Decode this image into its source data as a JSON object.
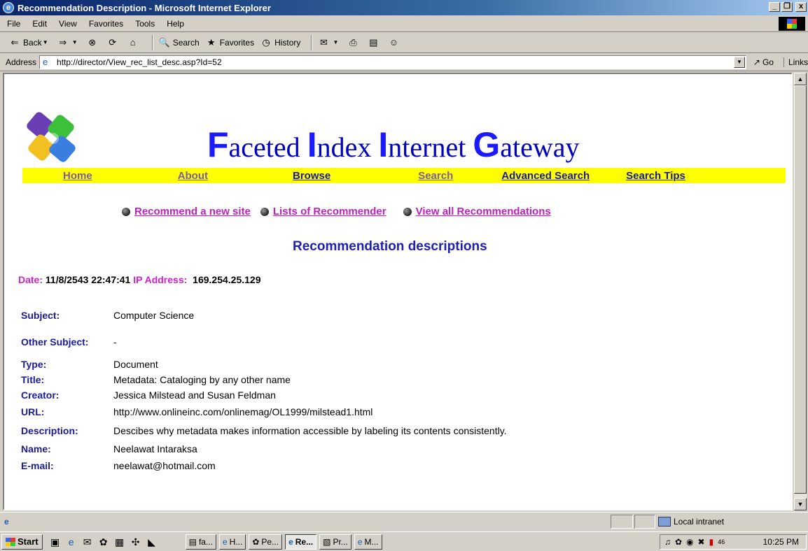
{
  "window": {
    "title": "Recommendation Description - Microsoft Internet Explorer",
    "buttons": [
      "_",
      "❐",
      "x"
    ]
  },
  "menu": [
    "File",
    "Edit",
    "View",
    "Favorites",
    "Tools",
    "Help"
  ],
  "toolbar": {
    "back": "Back",
    "search": "Search",
    "favorites": "Favorites",
    "history": "History"
  },
  "address": {
    "label": "Address",
    "url": "http://director/View_rec_list_desc.asp?Id=52",
    "go": "Go",
    "links": "Links"
  },
  "site": {
    "title_parts": [
      {
        "cap": "F",
        "rest": "aceted "
      },
      {
        "cap": "I",
        "rest": "ndex "
      },
      {
        "cap": "I",
        "rest": "nternet "
      },
      {
        "cap": "G",
        "rest": "ateway"
      }
    ],
    "nav": [
      "Home",
      "About",
      "Browse",
      "Search",
      "Advanced Search",
      "Search Tips"
    ],
    "recommend_links": [
      "Recommend a new site",
      "Lists of Recommender",
      "View all Recommendations"
    ],
    "heading": "Recommendation descriptions",
    "meta": {
      "date_label": "Date:",
      "date_value": "11/8/2543 22:47:41",
      "ip_label": "IP Address:",
      "ip_value": "169.254.25.129"
    },
    "fields": [
      {
        "label": "Subject:",
        "value": "Computer Science"
      },
      {
        "label": "Other Subject:",
        "value": "-"
      },
      {
        "label": "Type:",
        "value": "Document"
      },
      {
        "label": "Title:",
        "value": "Metadata: Cataloging by any other name"
      },
      {
        "label": "Creator:",
        "value": "Jessica Milstead and Susan Feldman"
      },
      {
        "label": "URL:",
        "value": "http://www.onlineinc.com/onlinemag/OL1999/milstead1.html"
      },
      {
        "label": "Description:",
        "value": "Descibes why metadata makes information accessible by labeling its contents consistently."
      },
      {
        "label": "Name:",
        "value": "Neelawat Intaraksa"
      },
      {
        "label": "E-mail:",
        "value": "neelawat@hotmail.com"
      }
    ]
  },
  "status": {
    "zone": "Local intranet"
  },
  "taskbar": {
    "start": "Start",
    "tasks": [
      {
        "label": "fa...",
        "active": false
      },
      {
        "label": "H...",
        "active": false
      },
      {
        "label": "Pe...",
        "active": false
      },
      {
        "label": "Re...",
        "active": true
      },
      {
        "label": "Pr...",
        "active": false
      },
      {
        "label": "M...",
        "active": false
      }
    ],
    "clock": "10:25 PM",
    "tray_number": "46"
  }
}
